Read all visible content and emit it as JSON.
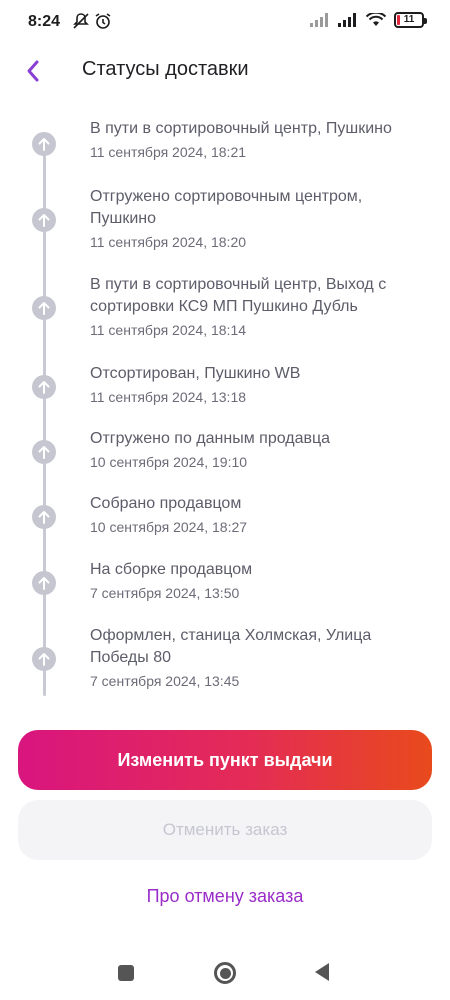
{
  "status_bar": {
    "time": "8:24",
    "battery_level": "11",
    "icons": [
      "notifications-off-icon",
      "alarm-icon",
      "signal-icon",
      "signal-icon",
      "wifi-icon",
      "battery-icon"
    ]
  },
  "header": {
    "back_icon": "chevron-left-icon",
    "title": "Статусы доставки"
  },
  "timeline": {
    "items": [
      {
        "title": "В пути в сортировочный центр, Пушкино",
        "date": "11 сентября 2024, 18:21"
      },
      {
        "title": "Отгружено сортировочным центром, Пушкино",
        "date": "11 сентября 2024, 18:20"
      },
      {
        "title": "В пути в сортировочный центр, Выход с сортировки КС9 МП Пушкино Дубль",
        "date": "11 сентября 2024, 18:14"
      },
      {
        "title": "Отсортирован, Пушкино WB",
        "date": "11 сентября 2024, 13:18"
      },
      {
        "title": "Отгружено по данным продавца",
        "date": "10 сентября 2024, 19:10"
      },
      {
        "title": "Собрано продавцом",
        "date": "10 сентября 2024, 18:27"
      },
      {
        "title": "На сборке продавцом",
        "date": "7 сентября 2024, 13:50"
      },
      {
        "title": "Оформлен, станица Холмская, Улица Победы 80",
        "date": "7 сентября 2024, 13:45"
      }
    ]
  },
  "actions": {
    "change_pickup_label": "Изменить пункт выдачи",
    "cancel_order_label": "Отменить заказ",
    "cancel_info_link": "Про отмену заказа"
  },
  "colors": {
    "accent": "#9a2cc8",
    "gradient_start": "#d9157f",
    "gradient_end": "#e84a1c"
  }
}
